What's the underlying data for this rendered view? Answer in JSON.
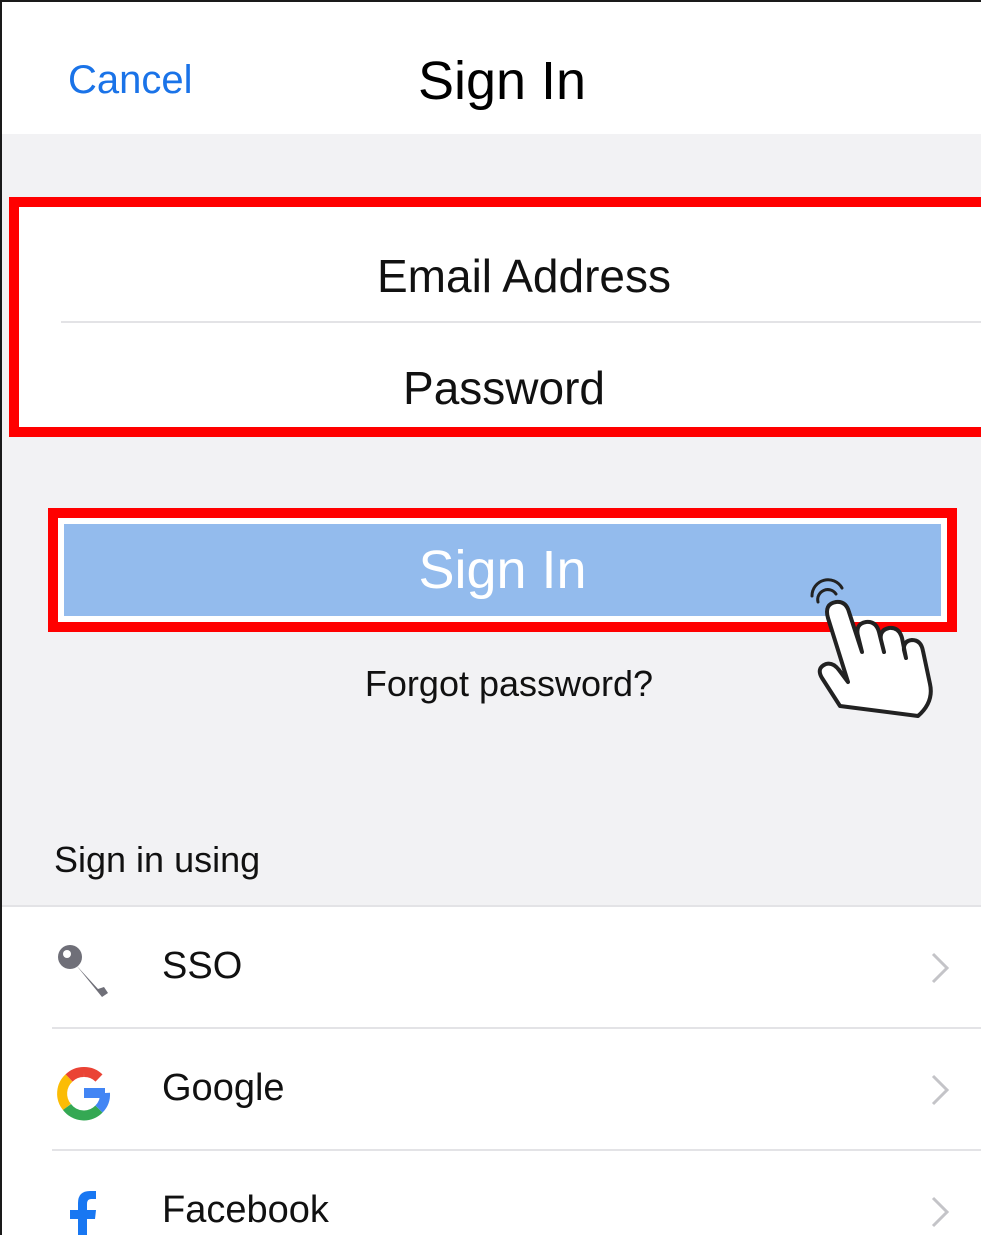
{
  "nav": {
    "cancel_label": "Cancel",
    "title": "Sign In"
  },
  "credentials": {
    "email_label": "Email Address",
    "password_label": "Password"
  },
  "sign_in_button": {
    "label": "Sign In"
  },
  "forgot_password": "Forgot password?",
  "providers": {
    "heading": "Sign in using",
    "items": [
      {
        "label": "SSO",
        "icon": "key-icon"
      },
      {
        "label": "Google",
        "icon": "google-icon"
      },
      {
        "label": "Facebook",
        "icon": "facebook-icon"
      }
    ]
  },
  "colors": {
    "link_blue": "#1a73e8",
    "button_blue": "#93bbed",
    "highlight_red": "#ff0000",
    "background_gray": "#f2f2f4"
  }
}
